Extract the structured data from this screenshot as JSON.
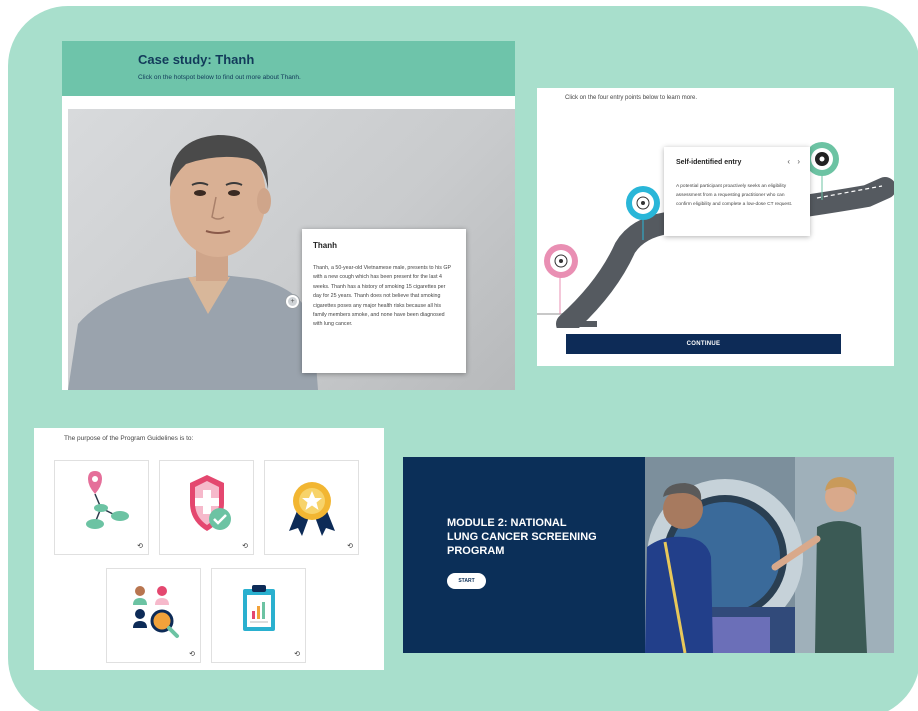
{
  "case_study": {
    "title": "Case study: Thanh",
    "subtitle": "Click on the hotspot below to find out more about Thanh.",
    "hotspot_icon": "plus-icon",
    "card": {
      "title": "Thanh",
      "body": "Thanh, a 50-year-old Vietnamese male, presents to his GP with a new cough which has been present for the last 4 weeks. Thanh has a history of smoking 15 cigarettes per day for 25 years. Thanh does not believe that smoking cigarettes poses any major health risks because all his family members smoke, and none have been diagnosed with lung cancer."
    }
  },
  "entry_points": {
    "instruction": "Click on the four entry points below to learn more.",
    "card": {
      "title": "Self-identified entry",
      "body": "A potential participant proactively seeks an eligibility assessment from a requesting practitioner who can confirm eligibility and complete a low-dose CT request.",
      "prev_icon": "‹",
      "next_icon": "›"
    },
    "pins": [
      {
        "name": "pink-pin",
        "color": "#e98fb3"
      },
      {
        "name": "cyan-pin",
        "color": "#29b6d8"
      },
      {
        "name": "green-pin",
        "color": "#6cc3a3"
      }
    ],
    "continue_label": "CONTINUE"
  },
  "guidelines": {
    "instruction": "The purpose of the Program Guidelines is to:",
    "flip_icon": "⟲",
    "tiles": [
      {
        "icon": "pathway-icon"
      },
      {
        "icon": "health-shield-icon"
      },
      {
        "icon": "award-ribbon-icon"
      },
      {
        "icon": "people-search-icon"
      },
      {
        "icon": "clipboard-chart-icon"
      }
    ]
  },
  "module": {
    "title": "MODULE 2: NATIONAL LUNG CANCER SCREENING PROGRAM",
    "start_label": "START",
    "background_color": "#0b2f58"
  }
}
